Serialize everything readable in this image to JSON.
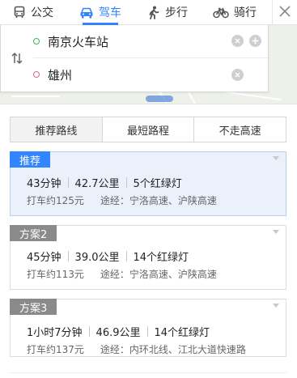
{
  "tabs": [
    {
      "label": "公交",
      "icon": "bus-icon"
    },
    {
      "label": "驾车",
      "icon": "car-icon"
    },
    {
      "label": "步行",
      "icon": "walk-icon"
    },
    {
      "label": "骑行",
      "icon": "bike-icon"
    }
  ],
  "active_tab": "驾车",
  "search": {
    "start": "南京火车站",
    "end": "雄州"
  },
  "strategy": {
    "options": [
      "推荐路线",
      "最短路程",
      "不走高速"
    ],
    "active": "推荐路线"
  },
  "plans": [
    {
      "badge": "推荐",
      "duration": "43分钟",
      "distance": "42.7公里",
      "lights": "5个红绿灯",
      "taxi": "打车约125元",
      "via": "途经：宁洛高速、沪陕高速",
      "selected": true
    },
    {
      "badge": "方案2",
      "duration": "45分钟",
      "distance": "39.0公里",
      "lights": "14个红绿灯",
      "taxi": "打车约113元",
      "via": "途经：宁洛高速、沪陕高速",
      "selected": false
    },
    {
      "badge": "方案3",
      "duration": "1小时7分钟",
      "distance": "46.9公里",
      "lights": "14个红绿灯",
      "taxi": "打车约137元",
      "via": "途经：内环北线、江北大道快速路",
      "selected": false
    }
  ],
  "colors": {
    "accent": "#3385ff",
    "start_dot": "#34b45c",
    "end_dot": "#e0609a",
    "selected_bg": "#eaf1fb",
    "badge_gray": "#8a8a8a"
  }
}
